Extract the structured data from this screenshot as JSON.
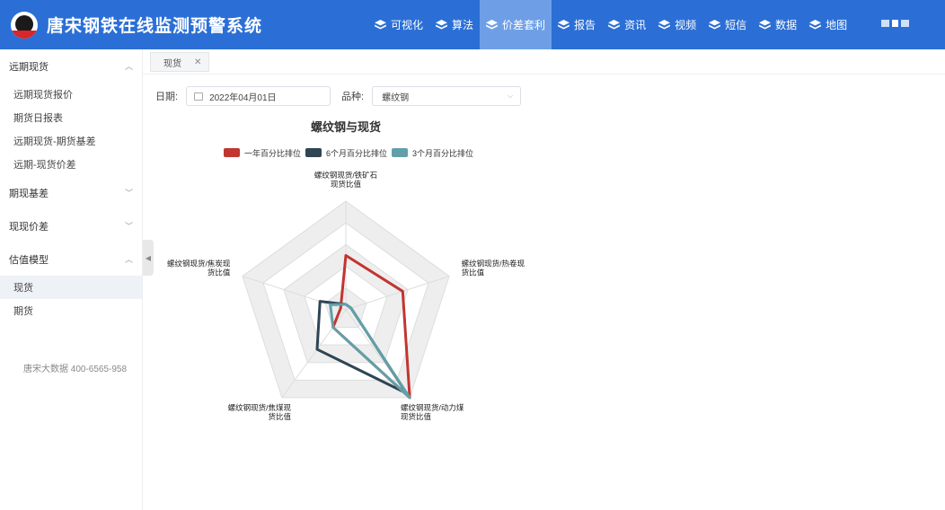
{
  "header": {
    "title": "唐宋钢铁在线监测预警系统",
    "nav": [
      {
        "label": "可视化",
        "active": false
      },
      {
        "label": "算法",
        "active": false
      },
      {
        "label": "价差套利",
        "active": true
      },
      {
        "label": "报告",
        "active": false
      },
      {
        "label": "资讯",
        "active": false
      },
      {
        "label": "视频",
        "active": false
      },
      {
        "label": "短信",
        "active": false
      },
      {
        "label": "数据",
        "active": false
      },
      {
        "label": "地图",
        "active": false
      }
    ]
  },
  "sidebar": {
    "groups": [
      {
        "label": "远期现货",
        "expanded": true,
        "items": [
          {
            "label": "远期现货报价",
            "active": false
          },
          {
            "label": "期货日报表",
            "active": false
          },
          {
            "label": "远期现货-期货基差",
            "active": false
          },
          {
            "label": "远期-现货价差",
            "active": false
          }
        ]
      },
      {
        "label": "期现基差",
        "expanded": false,
        "items": []
      },
      {
        "label": "现现价差",
        "expanded": false,
        "items": []
      },
      {
        "label": "估值模型",
        "expanded": true,
        "items": [
          {
            "label": "现货",
            "active": true
          },
          {
            "label": "期货",
            "active": false
          }
        ]
      }
    ],
    "footer": "唐宋大数据 400-6565-958"
  },
  "tabs": [
    {
      "label": "现货"
    }
  ],
  "filters": {
    "date_label": "日期:",
    "date_value": "2022年04月01日",
    "variety_label": "品种:",
    "variety_value": "螺纹钢"
  },
  "chart_data": {
    "type": "radar",
    "title": "螺纹钢与现货",
    "indicators": [
      [
        "螺纹钢现货/铁矿石",
        "现货比值"
      ],
      [
        "螺纹钢现货/热卷现",
        "货比值"
      ],
      [
        "螺纹钢现货/动力煤",
        "现货比值"
      ],
      [
        "螺纹钢现货/焦煤现",
        "货比值"
      ],
      [
        "螺纹钢现货/焦炭现",
        "货比值"
      ]
    ],
    "max": 1,
    "series": [
      {
        "name": "一年百分比排位",
        "color": "#c23531",
        "values": [
          0.5,
          0.55,
          1.0,
          0.2,
          0.05
        ]
      },
      {
        "name": "6个月百分比排位",
        "color": "#2f4554",
        "values": [
          0.05,
          0.05,
          0.95,
          0.45,
          0.25
        ]
      },
      {
        "name": "3个月百分比排位",
        "color": "#61a0a8",
        "values": [
          0.05,
          0.05,
          1.0,
          0.2,
          0.15
        ]
      }
    ],
    "legend_position": "top-center"
  }
}
